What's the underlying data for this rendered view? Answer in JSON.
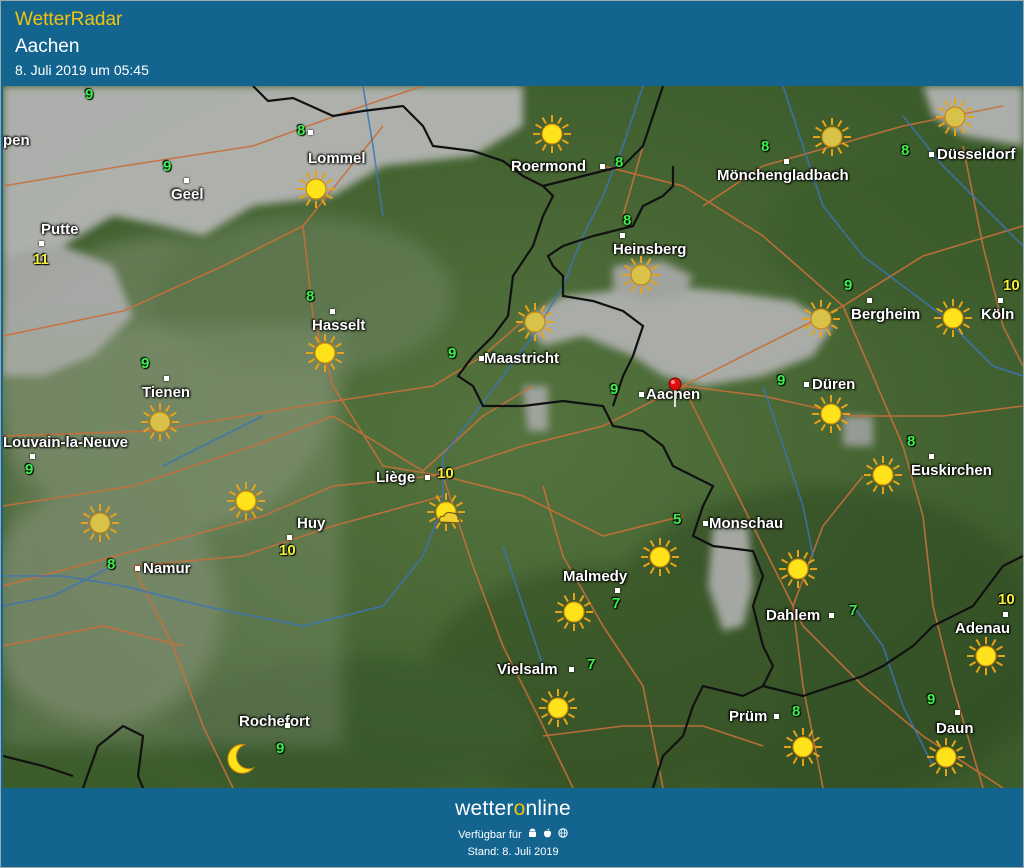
{
  "header": {
    "app_title": "WetterRadar",
    "location": "Aachen",
    "timestamp": "8. Juli 2019 um 05:45"
  },
  "footer": {
    "brand_pre": "wetter",
    "brand_o": "o",
    "brand_post": "nline",
    "available_label": "Verfügbar für",
    "platform_icons": [
      "android-icon",
      "apple-icon",
      "web-icon"
    ],
    "stand": "Stand: 8. Juli 2019"
  },
  "colors": {
    "header_bg": "#136590",
    "brand_accent": "#f4c20d",
    "temp_green": "#3df04d",
    "temp_yellow": "#f6f03a",
    "marker_red": "#e01010"
  },
  "selected_location_marker": "Aachen",
  "cities": [
    {
      "name": "Lommel",
      "temp": "8",
      "icon": "sun-icon"
    },
    {
      "name": "Geel",
      "temp": "9",
      "icon": ""
    },
    {
      "name": "Putte",
      "temp": "11",
      "icon": ""
    },
    {
      "name": "Roermond",
      "temp": "8",
      "icon": "sun-icon"
    },
    {
      "name": "Mönchengladbach",
      "temp": "8",
      "icon": "sun-icon"
    },
    {
      "name": "Düsseldorf",
      "temp": "8",
      "icon": "sun-icon"
    },
    {
      "name": "Heinsberg",
      "temp": "8",
      "icon": "sun-icon"
    },
    {
      "name": "Hasselt",
      "temp": "8",
      "icon": "sun-icon"
    },
    {
      "name": "Maastricht",
      "temp": "9",
      "icon": "sun-icon"
    },
    {
      "name": "Bergheim",
      "temp": "9",
      "icon": "sun-icon"
    },
    {
      "name": "Köln",
      "temp": "10",
      "icon": "sun-icon"
    },
    {
      "name": "Tienen",
      "temp": "9",
      "icon": "sun-icon"
    },
    {
      "name": "Aachen",
      "temp": "9",
      "icon": ""
    },
    {
      "name": "Düren",
      "temp": "9",
      "icon": "sun-icon"
    },
    {
      "name": "Louvain-la-Neuve",
      "temp": "9",
      "icon": "sun-icon"
    },
    {
      "name": "Liège",
      "temp": "10",
      "icon": "sun-cloud-icon"
    },
    {
      "name": "Euskirchen",
      "temp": "8",
      "icon": "sun-icon"
    },
    {
      "name": "Huy",
      "temp": "10",
      "icon": "sun-icon"
    },
    {
      "name": "Monschau",
      "temp": "5",
      "icon": "sun-icon"
    },
    {
      "name": "Namur",
      "temp": "8",
      "icon": "sun-icon"
    },
    {
      "name": "Malmedy",
      "temp": "7",
      "icon": "sun-icon"
    },
    {
      "name": "Dahlem",
      "temp": "7",
      "icon": "sun-icon"
    },
    {
      "name": "Adenau",
      "temp": "10",
      "icon": "sun-icon"
    },
    {
      "name": "Vielsalm",
      "temp": "7",
      "icon": "sun-icon"
    },
    {
      "name": "Rochefort",
      "temp": "9",
      "icon": "moon-icon"
    },
    {
      "name": "Prüm",
      "temp": "8",
      "icon": "sun-icon"
    },
    {
      "name": "Daun",
      "temp": "9",
      "icon": "sun-icon"
    }
  ],
  "edge_labels": [
    "pen",
    "9"
  ]
}
